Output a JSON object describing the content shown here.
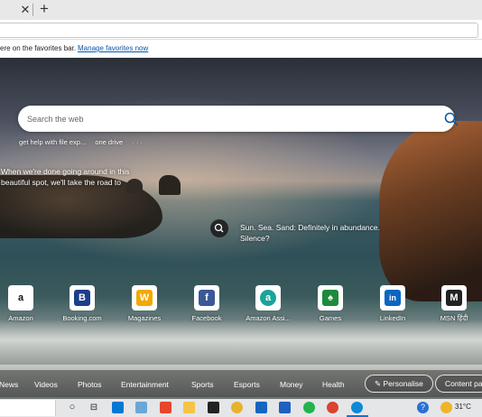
{
  "browser": {
    "tab_close_glyph": "✕",
    "new_tab_glyph": "+"
  },
  "favorites_bar": {
    "message": "ere on the favorites bar.",
    "manage_link": "Manage favorites now"
  },
  "search": {
    "placeholder": "Search the web",
    "suggestions": [
      "get help with file exp...",
      "one drive",
      "· · ·"
    ]
  },
  "image_info": {
    "caption": "When we're done going around in this beautiful spot, we'll take the road to",
    "spotlight_text": "Sun. Sea. Sand: Definitely in abundance. Silence?"
  },
  "tiles": [
    {
      "label": "Amazon",
      "icon": "amazon-icon",
      "glyph": "a",
      "color": "#ffffff",
      "glyph_color": "#111111"
    },
    {
      "label": "Booking.com",
      "icon": "booking-icon",
      "glyph": "B",
      "color": "#1b3f8b",
      "glyph_color": "#ffffff"
    },
    {
      "label": "Magazines",
      "icon": "magazines-icon",
      "glyph": "W",
      "color": "#f2a900",
      "glyph_color": "#ffffff"
    },
    {
      "label": "Facebook",
      "icon": "facebook-icon",
      "glyph": "f",
      "color": "#3b5998",
      "glyph_color": "#ffffff"
    },
    {
      "label": "Amazon Assi...",
      "icon": "amazon-assistant-icon",
      "glyph": "a",
      "color": "#1aa39a",
      "glyph_color": "#ffffff"
    },
    {
      "label": "Games",
      "icon": "games-icon",
      "glyph": "♠",
      "color": "#1e8a3c",
      "glyph_color": "#ffffff"
    },
    {
      "label": "LinkedIn",
      "icon": "linkedin-icon",
      "glyph": "in",
      "color": "#0a66c2",
      "glyph_color": "#ffffff"
    },
    {
      "label": "MSN हिंदी",
      "icon": "msn-hindi-icon",
      "glyph": "M",
      "color": "#222222",
      "glyph_color": "#ffffff"
    }
  ],
  "news_nav": {
    "items": [
      "News",
      "Videos",
      "Photos",
      "Entertainment",
      "Sports",
      "Esports",
      "Money",
      "Health"
    ],
    "personalise": "Personalise",
    "content": "Content pa"
  },
  "taskbar": {
    "temperature": "31°C",
    "help_glyph": "?"
  }
}
